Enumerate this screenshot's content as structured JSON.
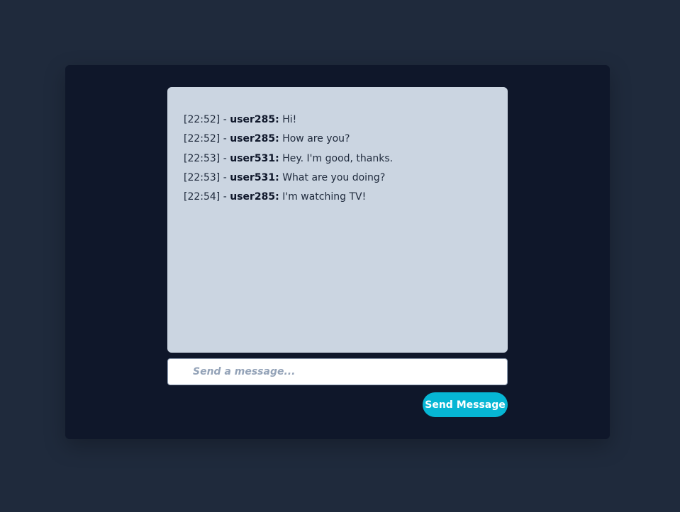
{
  "chat": {
    "messages": [
      {
        "time": "[22:52]",
        "separator": " - ",
        "user": "user285:",
        "text": " Hi!"
      },
      {
        "time": "[22:52]",
        "separator": " - ",
        "user": "user285:",
        "text": " How are you?"
      },
      {
        "time": "[22:53]",
        "separator": " - ",
        "user": "user531:",
        "text": " Hey. I'm good, thanks."
      },
      {
        "time": "[22:53]",
        "separator": " - ",
        "user": "user531:",
        "text": " What are you doing?"
      },
      {
        "time": "[22:54]",
        "separator": " - ",
        "user": "user285:",
        "text": " I'm watching TV!"
      }
    ]
  },
  "composer": {
    "value": "",
    "placeholder": "Send a message...",
    "send_label": "Send Message"
  },
  "colors": {
    "page_bg": "#1f2a3c",
    "card_bg": "#0f172a",
    "chat_bg": "#cbd5e1",
    "accent": "#06b6d4"
  }
}
